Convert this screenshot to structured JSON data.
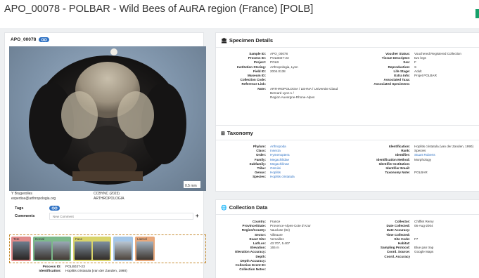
{
  "header": {
    "title": "APO_00078 - POLBAR - Wild Bees of AuRA region (France) [POLB]"
  },
  "specimen_card": {
    "id": "APO_00078",
    "image_scale": "0.5 mm",
    "credits": [
      {
        "left": "Y Brugerolles",
        "right": "CCBYNC (2023)"
      },
      {
        "left": "expertise@arthropologia.org",
        "right": "ARTHROPOLOGIA"
      }
    ],
    "tags_label": "Tags",
    "comments_label": "Comments",
    "comment_placeholder": "New Comment",
    "add_symbol": "+",
    "thumb_groups": [
      {
        "label": "Tete",
        "color": "#e08a8a",
        "count": 1
      },
      {
        "label": "Dorsal",
        "color": "#7cb98a",
        "count": 2
      },
      {
        "label": "Face",
        "color": "#d9d46a",
        "count": 2
      },
      {
        "label": "",
        "color": "#a3c6e8",
        "count": 1
      },
      {
        "label": "Lateral",
        "color": "#e8a77a",
        "count": 1
      }
    ],
    "info": [
      {
        "label": "Process ID:",
        "value": "POLB027-23"
      },
      {
        "label": "Identification:",
        "value": "Hoplitis cristatula (van der Zanden, 1990)"
      }
    ]
  },
  "specimen_details": {
    "title": "Specimen Details",
    "left": [
      {
        "label": "Sample ID:",
        "value": "APO_00078"
      },
      {
        "label": "Process ID:",
        "value": "POLB027-23"
      },
      {
        "label": "Project:",
        "value": "POLB"
      },
      {
        "label": "Institution Storing:",
        "value": "Arthropologia, Lyon"
      },
      {
        "label": "Field ID:",
        "value": "2004.0138"
      },
      {
        "label": "Museum ID:",
        "value": ""
      },
      {
        "label": "Collection Code:",
        "value": ""
      },
      {
        "label": "Reference Link:",
        "value": ""
      },
      {
        "label": "Note:",
        "value": "ARTHROPOLOGIA / LEHNA / Universite Claud"
      },
      {
        "label": "",
        "value": "Bernard Lyon 1 /"
      },
      {
        "label": "",
        "value": "Region Auvergne-Rhone-Alpes"
      }
    ],
    "right": [
      {
        "label": "Voucher Status:",
        "value": "Vouchered:Registered Collection"
      },
      {
        "label": "Tissue Descriptor:",
        "value": "two legs"
      },
      {
        "label": "Sex:",
        "value": "F"
      },
      {
        "label": "Reproduction:",
        "value": "S"
      },
      {
        "label": "Life Stage:",
        "value": "Adult"
      },
      {
        "label": "Extra Info:",
        "value": "Projet POLBAR"
      },
      {
        "label": "Associated Taxa:",
        "value": ""
      },
      {
        "label": "Associated Specimens:",
        "value": ""
      }
    ]
  },
  "taxonomy": {
    "title": "Taxonomy",
    "left": [
      {
        "label": "Phylum:",
        "value": "Arthropoda"
      },
      {
        "label": "Class:",
        "value": "Insecta"
      },
      {
        "label": "Order:",
        "value": "Hymenoptera"
      },
      {
        "label": "Family:",
        "value": "Megachilidae"
      },
      {
        "label": "Subfamily:",
        "value": "Megachilinae"
      },
      {
        "label": "Tribe:",
        "value": "Osmiini"
      },
      {
        "label": "Genus:",
        "value": "Hoplitis"
      },
      {
        "label": "Species:",
        "value": "Hoplitis cristatula"
      }
    ],
    "right": [
      {
        "label": "Identification:",
        "value": "Hoplitis cristatula (van der Zanden, 1990)",
        "link": false
      },
      {
        "label": "Rank:",
        "value": "Species",
        "link": false
      },
      {
        "label": "Identifier:",
        "value": "Stuart Roberts",
        "link": true
      },
      {
        "label": "Identification Method:",
        "value": "Morphology",
        "link": false
      },
      {
        "label": "Identifier Institution:",
        "value": "",
        "link": false
      },
      {
        "label": "Identifier Email:",
        "value": "",
        "link": false
      },
      {
        "label": "Taxonomy Note:",
        "value": "POLBAR",
        "link": false
      }
    ]
  },
  "collection_data": {
    "title": "Collection Data",
    "left": [
      {
        "label": "Country:",
        "value": "France"
      },
      {
        "label": "Province/State:",
        "value": "Provence-Alpes-Cote d'Azur"
      },
      {
        "label": "Region/County:",
        "value": "Vaucluse (84)"
      },
      {
        "label": "Sector:",
        "value": "Villeaure"
      },
      {
        "label": "Exact Site:",
        "value": "Versailles"
      },
      {
        "label": "Lat/Lon:",
        "value": "43.707, 5.407"
      },
      {
        "label": "Elevation:",
        "value": "165 m"
      },
      {
        "label": "Elevation Accuracy:",
        "value": ""
      },
      {
        "label": "Depth:",
        "value": ""
      },
      {
        "label": "Depth Accuracy:",
        "value": ""
      },
      {
        "label": "Collection Event ID:",
        "value": ""
      },
      {
        "label": "Collection Notes:",
        "value": ""
      }
    ],
    "right": [
      {
        "label": "Collector:",
        "value": "Chifflet Remy"
      },
      {
        "label": "Date Collected:",
        "value": "06-Aug-2004"
      },
      {
        "label": "Date Accuracy:",
        "value": ""
      },
      {
        "label": "Time Collected:",
        "value": ""
      },
      {
        "label": "Site Code:",
        "value": "F7"
      },
      {
        "label": "Habitat:",
        "value": ""
      },
      {
        "label": "Sampling Protocol:",
        "value": "Blue pan trap"
      },
      {
        "label": "Coord. Source:",
        "value": "Google Maps"
      },
      {
        "label": "Coord. Accuracy",
        "value": ""
      }
    ]
  }
}
